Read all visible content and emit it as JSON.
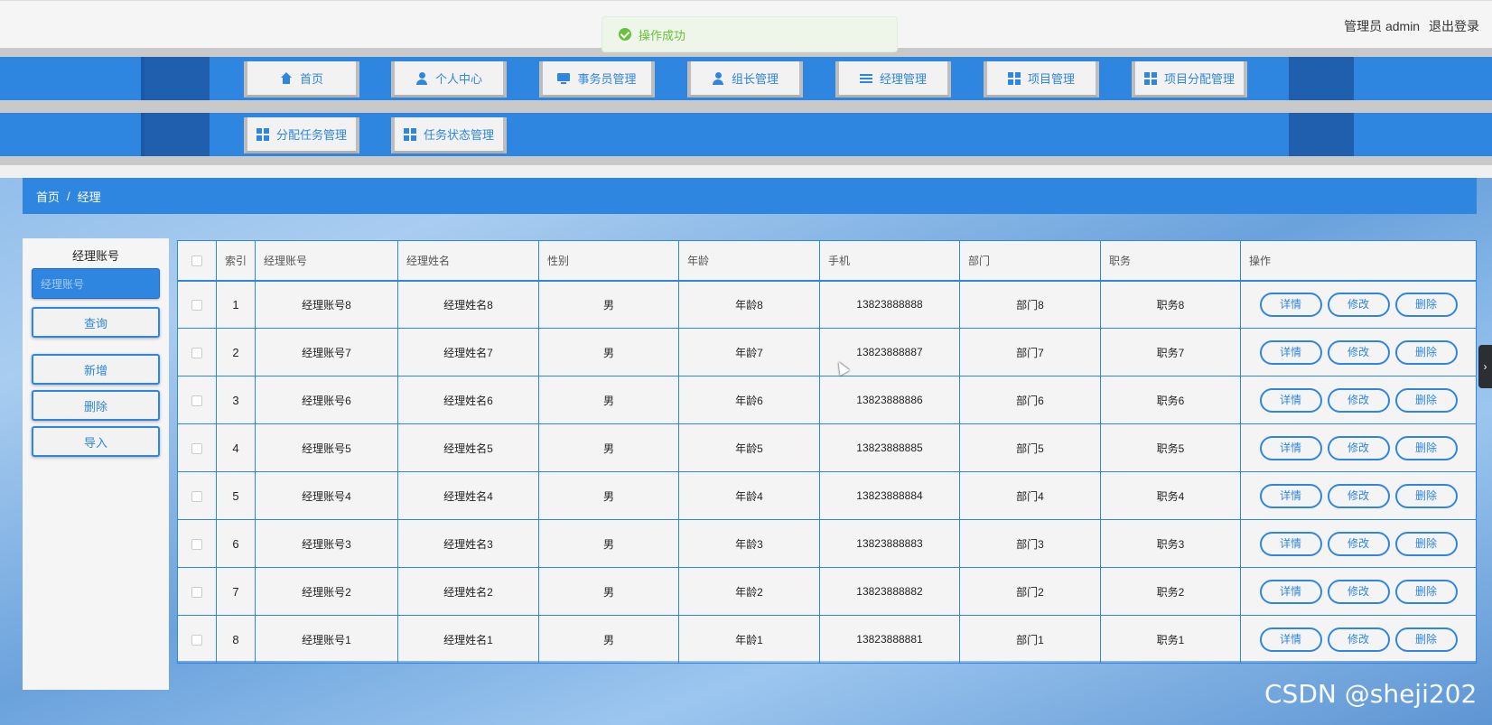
{
  "header": {
    "user_label": "管理员 admin",
    "logout_label": "退出登录"
  },
  "toast": {
    "message": "操作成功",
    "color": "#67c23a"
  },
  "nav": {
    "row1": [
      {
        "label": "首页",
        "icon": "home-icon"
      },
      {
        "label": "个人中心",
        "icon": "user-icon"
      },
      {
        "label": "事务员管理",
        "icon": "monitor-icon"
      },
      {
        "label": "组长管理",
        "icon": "user-icon"
      },
      {
        "label": "经理管理",
        "icon": "list-icon"
      },
      {
        "label": "项目管理",
        "icon": "grid-icon"
      },
      {
        "label": "项目分配管理",
        "icon": "grid-icon"
      }
    ],
    "row2": [
      {
        "label": "分配任务管理",
        "icon": "grid-icon"
      },
      {
        "label": "任务状态管理",
        "icon": "grid-icon"
      }
    ]
  },
  "breadcrumb": {
    "home": "首页",
    "separator": "/",
    "current": "经理"
  },
  "search": {
    "label": "经理账号",
    "placeholder": "经理账号",
    "query_button": "查询",
    "add_button": "新增",
    "delete_button": "删除",
    "import_button": "导入"
  },
  "table": {
    "headers": [
      "索引",
      "经理账号",
      "经理姓名",
      "性别",
      "年龄",
      "手机",
      "部门",
      "职务",
      "操作"
    ],
    "actions": {
      "detail": "详情",
      "edit": "修改",
      "delete": "删除"
    },
    "rows": [
      {
        "index": "1",
        "account": "经理账号8",
        "name": "经理姓名8",
        "gender": "男",
        "age": "年龄8",
        "phone": "13823888888",
        "dept": "部门8",
        "title": "职务8"
      },
      {
        "index": "2",
        "account": "经理账号7",
        "name": "经理姓名7",
        "gender": "男",
        "age": "年龄7",
        "phone": "13823888887",
        "dept": "部门7",
        "title": "职务7"
      },
      {
        "index": "3",
        "account": "经理账号6",
        "name": "经理姓名6",
        "gender": "男",
        "age": "年龄6",
        "phone": "13823888886",
        "dept": "部门6",
        "title": "职务6"
      },
      {
        "index": "4",
        "account": "经理账号5",
        "name": "经理姓名5",
        "gender": "男",
        "age": "年龄5",
        "phone": "13823888885",
        "dept": "部门5",
        "title": "职务5"
      },
      {
        "index": "5",
        "account": "经理账号4",
        "name": "经理姓名4",
        "gender": "男",
        "age": "年龄4",
        "phone": "13823888884",
        "dept": "部门4",
        "title": "职务4"
      },
      {
        "index": "6",
        "account": "经理账号3",
        "name": "经理姓名3",
        "gender": "男",
        "age": "年龄3",
        "phone": "13823888883",
        "dept": "部门3",
        "title": "职务3"
      },
      {
        "index": "7",
        "account": "经理账号2",
        "name": "经理姓名2",
        "gender": "男",
        "age": "年龄2",
        "phone": "13823888882",
        "dept": "部门2",
        "title": "职务2"
      },
      {
        "index": "8",
        "account": "经理账号1",
        "name": "经理姓名1",
        "gender": "男",
        "age": "年龄1",
        "phone": "13823888881",
        "dept": "部门1",
        "title": "职务1"
      }
    ]
  },
  "watermark": "CSDN @sheji202",
  "side_tab_glyph": "›",
  "colors": {
    "primary": "#2f86e0",
    "dark": "#1f5fae"
  }
}
